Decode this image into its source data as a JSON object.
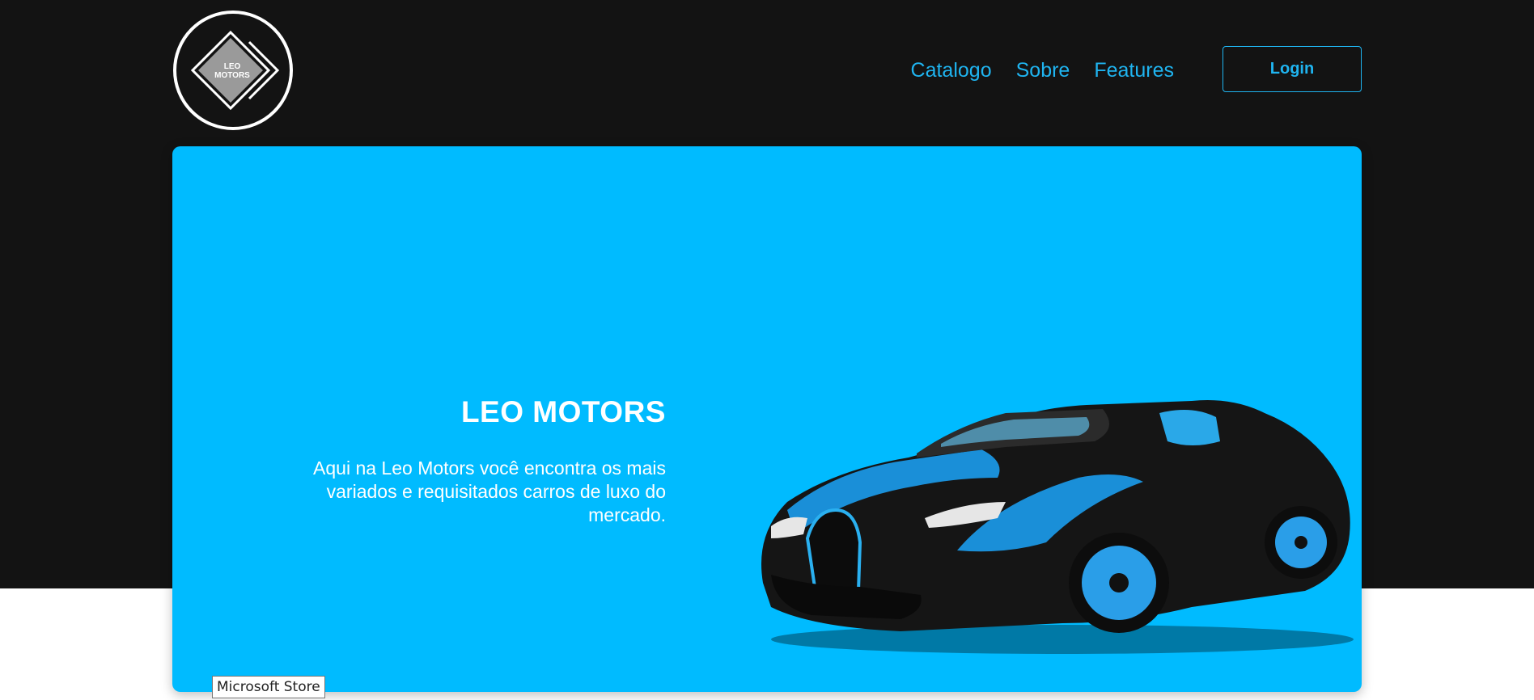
{
  "header": {
    "logo_line1": "LEO",
    "logo_line2": "MOTORS",
    "nav": [
      "Catalogo",
      "Sobre",
      "Features"
    ],
    "login_label": "Login"
  },
  "hero": {
    "title": "LEO MOTORS",
    "description": "Aqui na Leo Motors você encontra os mais variados e requisitados carros de luxo do mercado."
  },
  "tooltip": "Microsoft Store",
  "colors": {
    "background_dark": "#131313",
    "accent": "#1fb4f0",
    "hero_bg": "#00bbff"
  }
}
